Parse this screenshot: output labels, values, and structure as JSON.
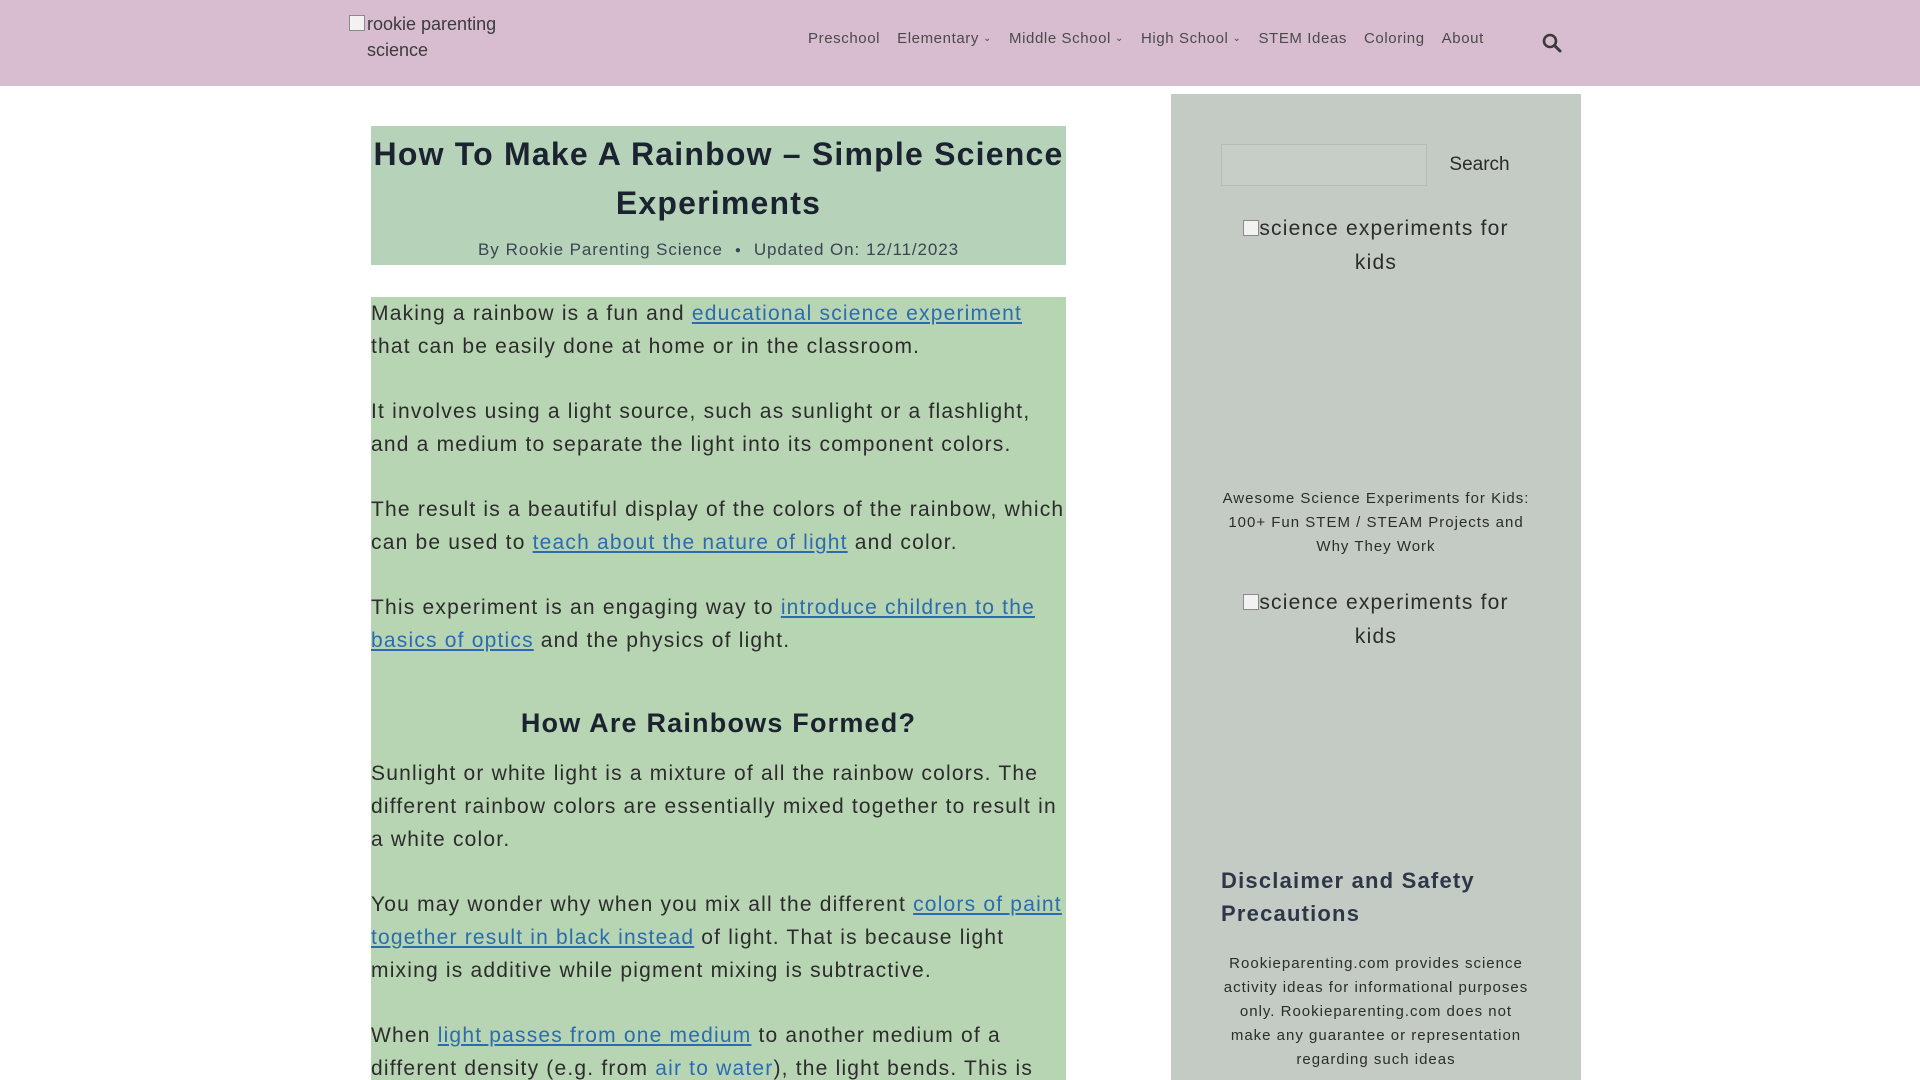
{
  "header": {
    "logo_alt": "rookie parenting science",
    "nav": [
      {
        "label": "Preschool",
        "has_dropdown": false
      },
      {
        "label": "Elementary",
        "has_dropdown": true
      },
      {
        "label": "Middle School",
        "has_dropdown": true
      },
      {
        "label": "High School",
        "has_dropdown": true
      },
      {
        "label": "STEM Ideas",
        "has_dropdown": false
      },
      {
        "label": "Coloring",
        "has_dropdown": false
      },
      {
        "label": "About",
        "has_dropdown": false
      }
    ],
    "search_icon": "search-icon"
  },
  "article": {
    "title": "How To Make A Rainbow – Simple Science Experiments",
    "byline": {
      "by": "By",
      "author": "Rookie Parenting Science",
      "updated_label": "Updated On:",
      "updated_date": "12/11/2023"
    },
    "p1": {
      "before": "Making a rainbow is a fun and ",
      "link": "educational science experiment",
      "after": " that can be easily done at home or in the classroom."
    },
    "p2": "It involves using a light source, such as sunlight or a flashlight, and a medium to separate the light into its component colors.",
    "p3": {
      "before": "The result is a beautiful display of the colors of the rainbow, which can be used to ",
      "link": "teach about the nature of light",
      "after": " and color."
    },
    "p4": {
      "before": "This experiment is an engaging way to ",
      "link": "introduce children to the basics of optics",
      "after": " and the physics of light."
    },
    "h2": "How Are Rainbows Formed?",
    "p5": "Sunlight or white light is a mixture of all the rainbow colors. The different rainbow colors are essentially mixed together to result in a white color.",
    "p6": {
      "before": "You may wonder why when you mix all the different ",
      "link": "colors of paint together result in black instead",
      "after": " of light. That is because light mixing is additive while pigment mixing is subtractive."
    },
    "p7": {
      "before": "When ",
      "link1": "light passes from one medium",
      "middle": " to another medium of a different density (e.g. from ",
      "link2": "air to water",
      "after": "), the light bends. This is"
    }
  },
  "sidebar": {
    "search_placeholder": "",
    "search_button": "Search",
    "image1_alt": "science experiments for kids",
    "caption": "Awesome Science Experiments for Kids: 100+ Fun STEM / STEAM Projects and Why They Work",
    "image2_alt": "science experiments for kids",
    "disclaimer_title": "Disclaimer and Safety Precautions",
    "disclaimer_text": "Rookieparenting.com provides science activity ideas for informational purposes only. Rookieparenting.com does not make any guarantee or representation regarding such ideas"
  },
  "colors": {
    "header_bg": "#d8bdd0",
    "title_bg": "#b6d3b9",
    "content_bg": "#b8d5b3",
    "sidebar_bg": "#c4cbc4",
    "link": "#2b6cb0"
  }
}
